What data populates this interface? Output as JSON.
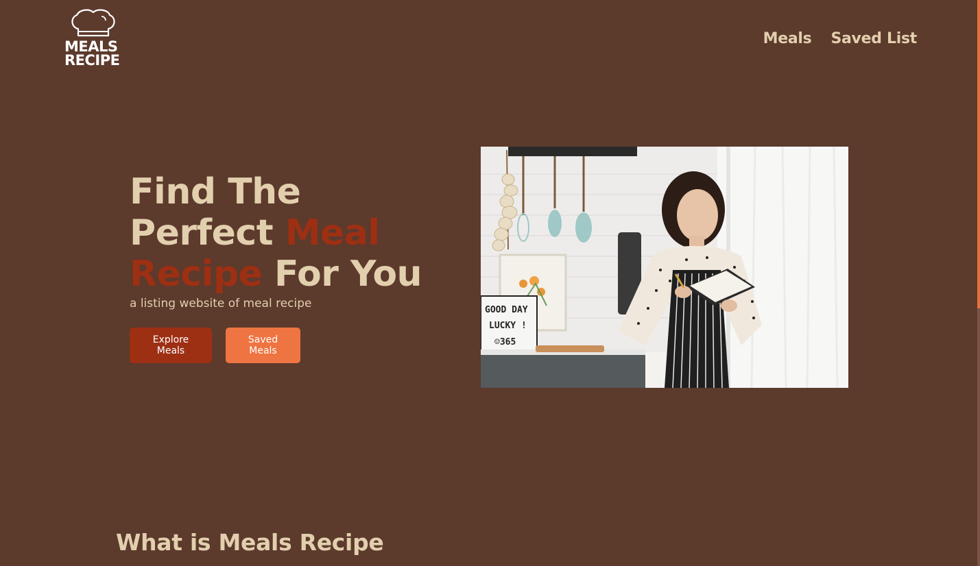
{
  "header": {
    "logo": {
      "line1": "MEALS",
      "line2": "RECIPE",
      "icon": "chef-hat-icon"
    },
    "nav": [
      {
        "label": "Meals"
      },
      {
        "label": "Saved List"
      }
    ]
  },
  "hero": {
    "title_part1": "Find The Perfect ",
    "title_accent": "Meal Recipe",
    "title_part2": " For You",
    "subtitle": "a listing website of meal recipe",
    "buttons": {
      "explore": "Explore Meals",
      "saved": "Saved Meals"
    },
    "image": {
      "sign_line1": "GOOD DAY",
      "sign_line2": "LUCKY !",
      "sign_line3": "☺365"
    }
  },
  "about": {
    "title": "What is Meals Recipe"
  },
  "colors": {
    "background": "#5c3a2c",
    "text_cream": "#e2cfae",
    "accent_red": "#9d2f13",
    "accent_orange": "#ee7442"
  }
}
